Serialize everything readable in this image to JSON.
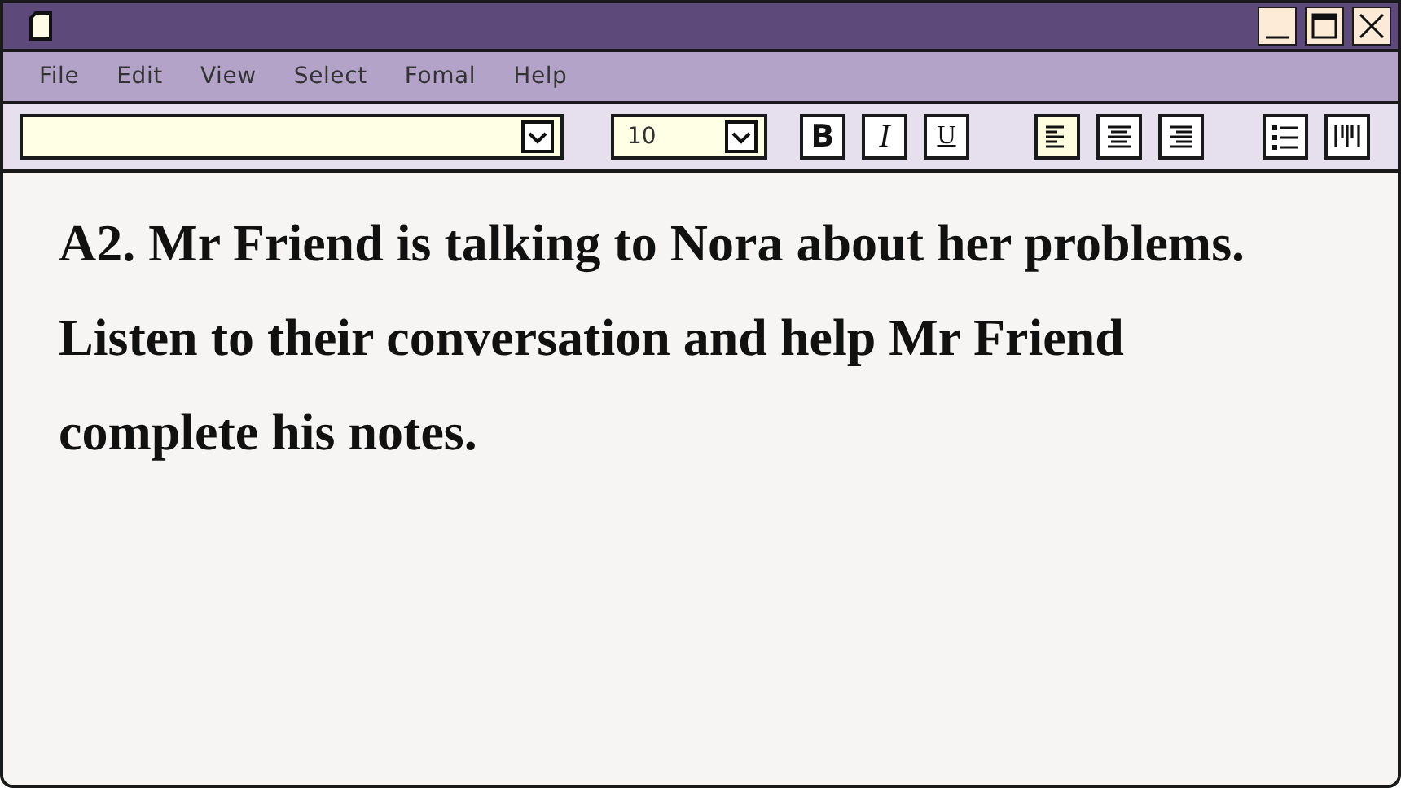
{
  "menu": [
    "File",
    "Edit",
    "View",
    "Select",
    "Fomal",
    "Help"
  ],
  "size_field": {
    "value": "10"
  },
  "format_buttons": [
    {
      "label": "B",
      "kind": "bold"
    },
    {
      "label": "I",
      "kind": "italic"
    },
    {
      "label": "U",
      "kind": "underline"
    }
  ],
  "align_buttons": [
    {
      "kind": "left",
      "selected": true
    },
    {
      "kind": "center",
      "selected": false
    },
    {
      "kind": "right",
      "selected": false
    }
  ],
  "document": {
    "paragraph": "A2. Mr Friend is talking to Nora about her problems. Listen to their conversation and help Mr Friend complete his notes."
  }
}
